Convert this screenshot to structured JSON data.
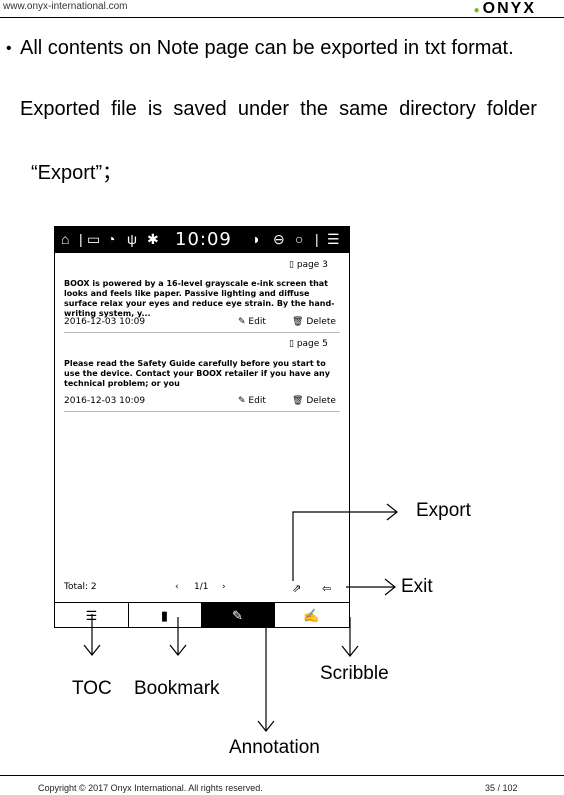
{
  "header": {
    "url": "www.onyx-international.com",
    "logo": "ONYX"
  },
  "body": {
    "line1": "All contents on Note page can be exported in txt format.",
    "line2": "Exported  file  is  saved  under  the  same  directory  folder",
    "line3": "“Export”；"
  },
  "device": {
    "time": "10:09",
    "notes": [
      {
        "page": "page 3",
        "text": "BOOX is powered by a 16-level grayscale e-ink screen that looks and feels like paper.  Passive lighting and diffuse surface relax your eyes and reduce eye strain. By the  hand-writing system, y...",
        "date": "2016-12-03 10:09",
        "edit": "Edit",
        "delete": "Delete"
      },
      {
        "page": "page 5",
        "text": "Please read the Safety Guide carefully before you start to use the device.  Contact your BOOX retailer if you have any technical problem; or you",
        "date": "2016-12-03 10:09",
        "edit": "Edit",
        "delete": "Delete"
      }
    ],
    "total": "Total: 2",
    "page_indicator": "1/1"
  },
  "callouts": {
    "export": "Export",
    "exit": "Exit",
    "toc": "TOC",
    "bookmark": "Bookmark",
    "scribble": "Scribble",
    "annotation": "Annotation"
  },
  "footer": {
    "copyright": "Copyright © 2017 Onyx International. All rights reserved.",
    "page": "35 / 102"
  }
}
